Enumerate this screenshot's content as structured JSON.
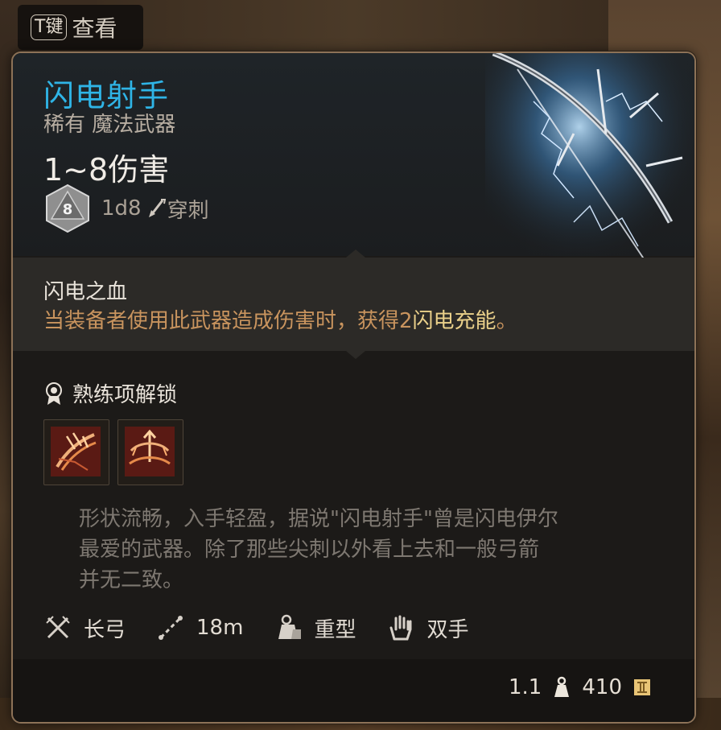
{
  "key_hint": {
    "key": "T键",
    "label": "查看"
  },
  "item": {
    "name": "闪电射手",
    "rarity_type": "稀有 魔法武器",
    "damage": "1~8伤害",
    "dice_face": "8",
    "dice_label": "1d8",
    "damage_type": "穿刺"
  },
  "passive": {
    "title": "闪电之血",
    "desc_prefix": "当装备者使用此武器造成伤害时，获得2",
    "desc_highlight": "闪电充能",
    "desc_suffix": "。"
  },
  "proficiency": {
    "label": "熟练项解锁",
    "skills": [
      {
        "icon": "bow-slash-skill-icon"
      },
      {
        "icon": "bow-target-skill-icon"
      }
    ]
  },
  "flavor_lines": [
    "形状流畅，入手轻盈，据说\"闪电射手\"曾是闪电伊尔",
    "最爱的武器。除了那些尖刺以外看上去和一般弓箭",
    "并无二致。"
  ],
  "properties": {
    "weapon_type": "长弓",
    "range": "18m",
    "weight_class": "重型",
    "handedness": "双手"
  },
  "footer": {
    "weight": "1.1",
    "value": "410"
  },
  "colors": {
    "title": "#2fb4e6",
    "passive_desc": "#c9945e",
    "highlight": "#ead08a",
    "border": "#8d7257"
  }
}
